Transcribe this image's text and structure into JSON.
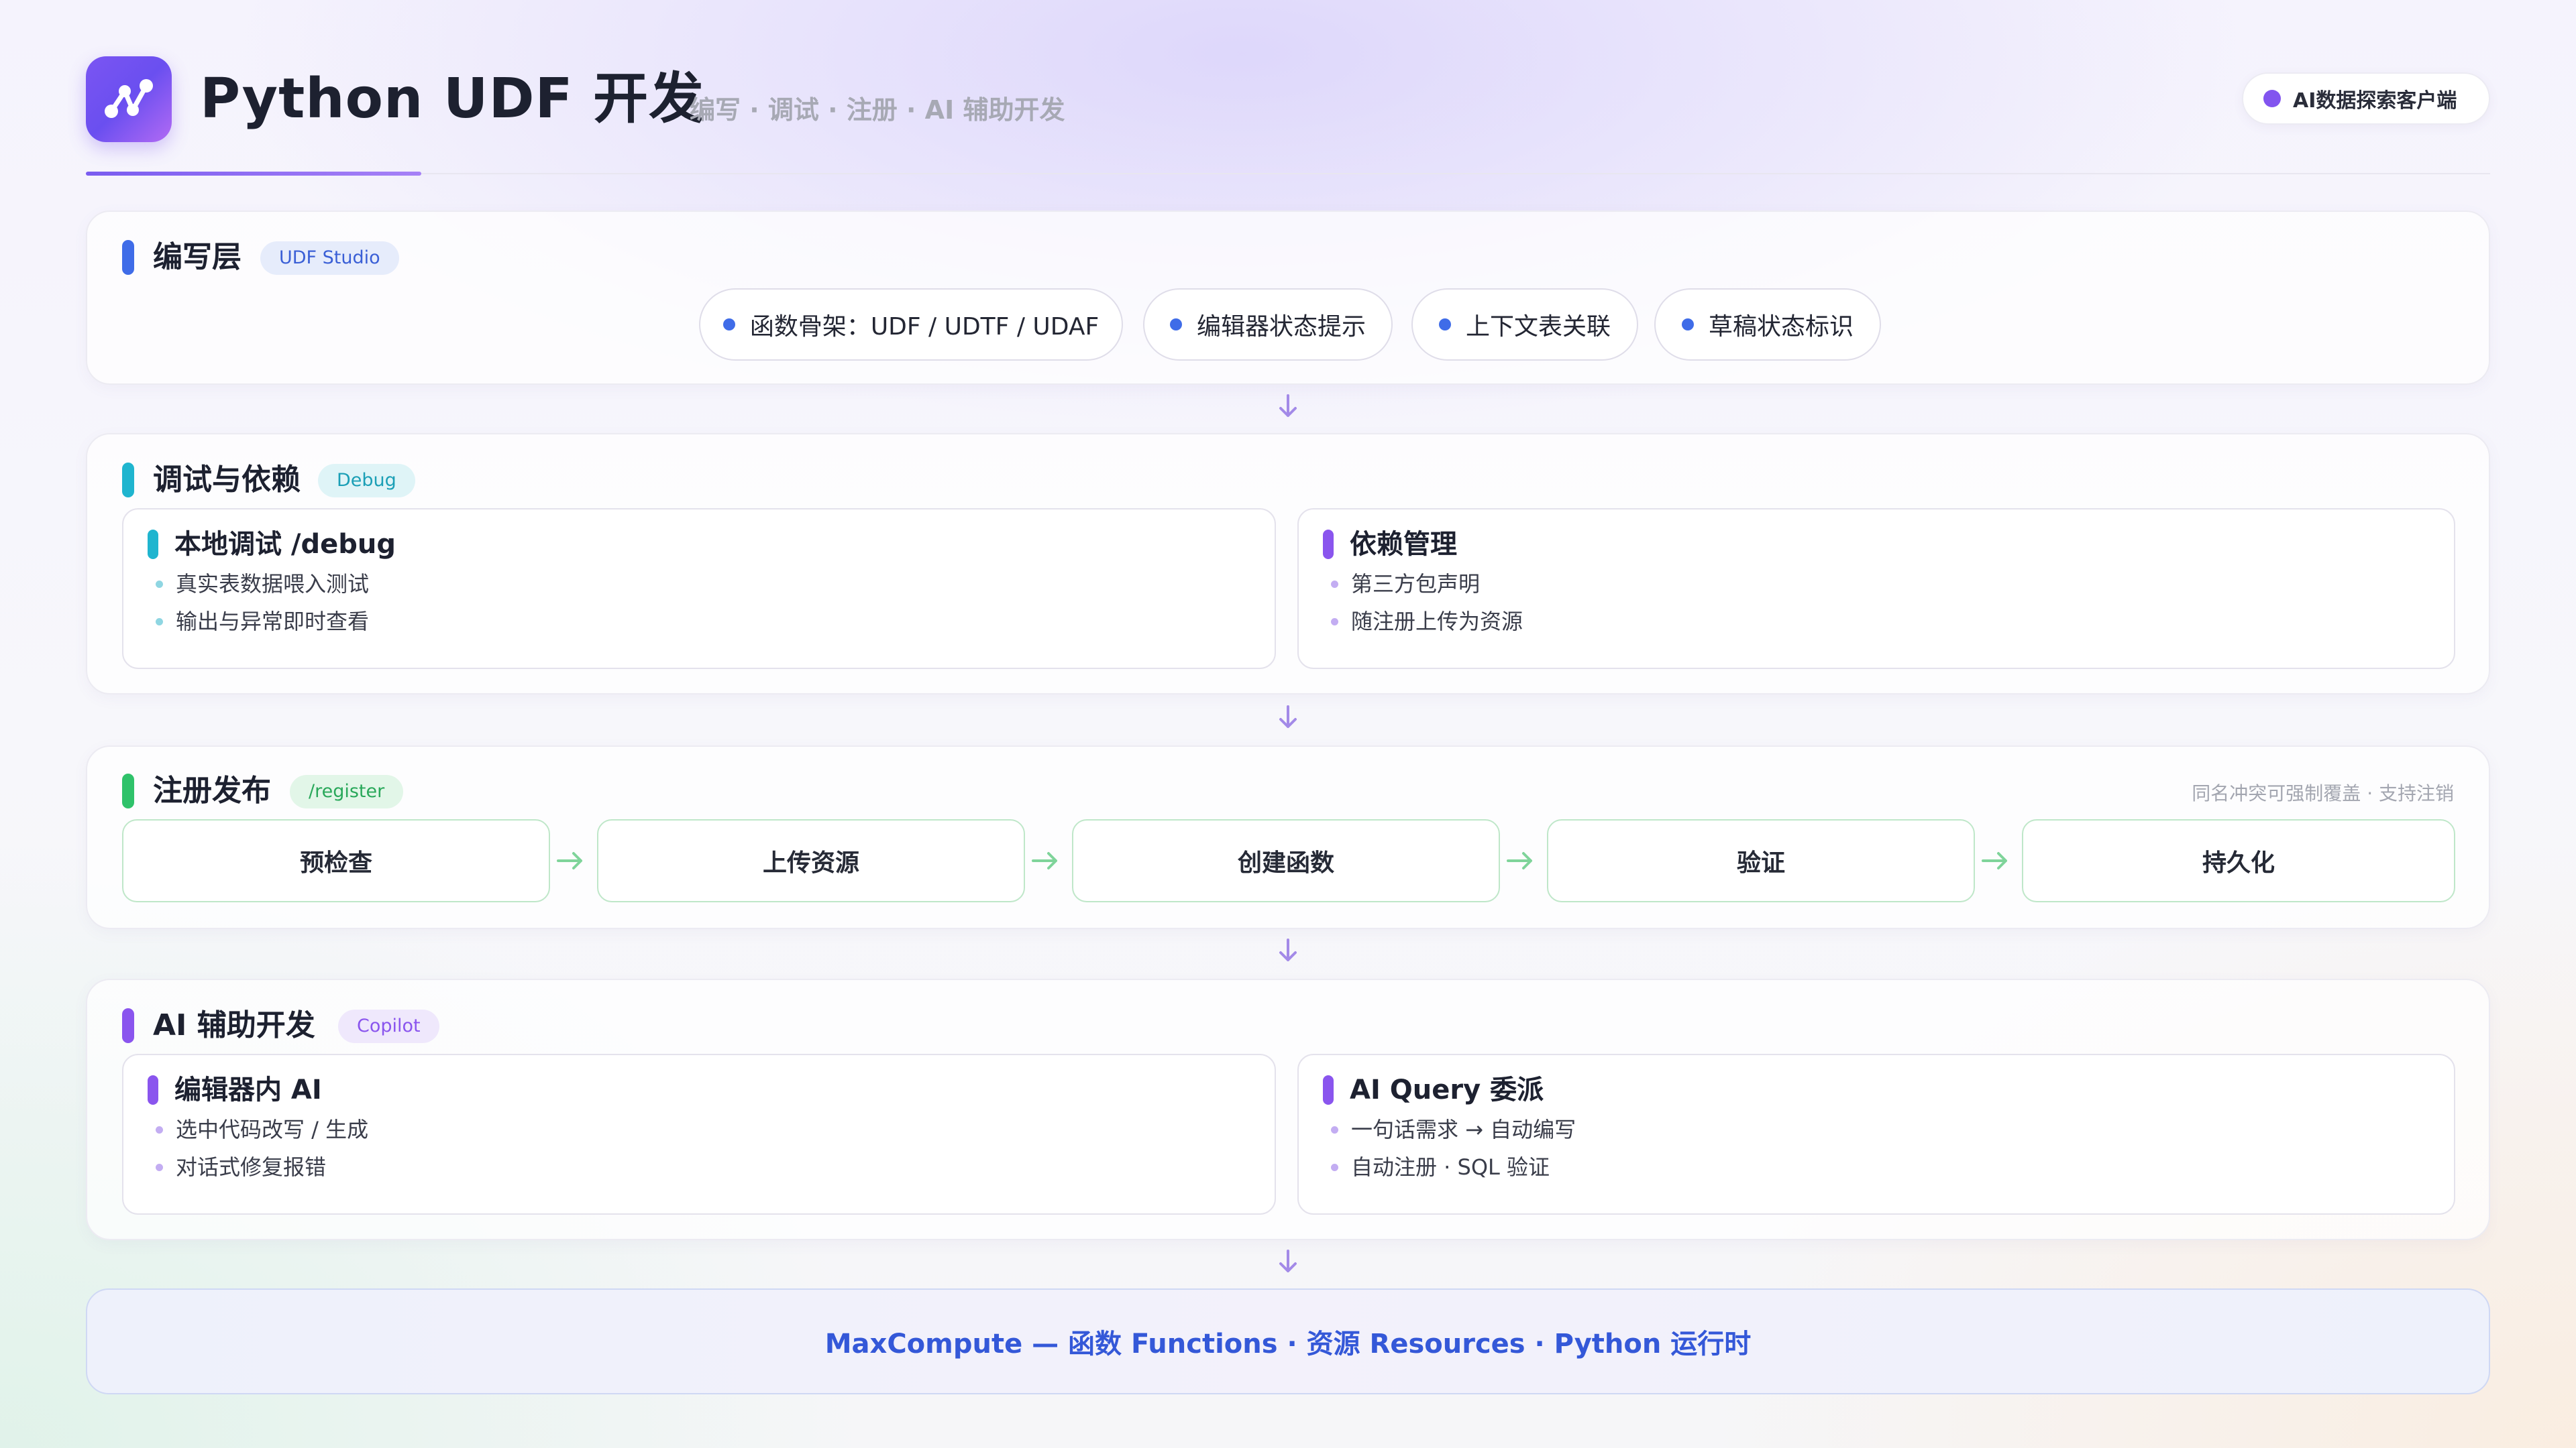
{
  "header": {
    "title": "Python UDF 开发",
    "subtitle": "编写 · 调试 · 注册 · AI 辅助开发",
    "badge": "AI数据探索客户端",
    "logo_icon": "branch-nodes-icon"
  },
  "colors": {
    "brand_purple": "#7b55f2",
    "blue": "#3f6ce8",
    "cyan": "#1fb5cf",
    "green": "#2fc26a",
    "violet": "#8a55ee",
    "footer_text": "#3458d8"
  },
  "sections": {
    "write": {
      "title": "编写层",
      "tag": "UDF Studio",
      "pills": [
        "函数骨架：UDF / UDTF / UDAF",
        "编辑器状态提示",
        "上下文表关联",
        "草稿状态标识"
      ]
    },
    "debug": {
      "title": "调试与依赖",
      "tag": "Debug",
      "cards": [
        {
          "title": "本地调试 /debug",
          "items": [
            "真实表数据喂入测试",
            "输出与异常即时查看"
          ]
        },
        {
          "title": "依赖管理",
          "items": [
            "第三方包声明",
            "随注册上传为资源"
          ]
        }
      ]
    },
    "register": {
      "title": "注册发布",
      "tag": "/register",
      "note": "同名冲突可强制覆盖 · 支持注销",
      "steps": [
        "预检查",
        "上传资源",
        "创建函数",
        "验证",
        "持久化"
      ]
    },
    "ai": {
      "title": "AI 辅助开发",
      "tag": "Copilot",
      "cards": [
        {
          "title": "编辑器内 AI",
          "items": [
            "选中代码改写 / 生成",
            "对话式修复报错"
          ]
        },
        {
          "title": "AI Query 委派",
          "items": [
            "一句话需求 → 自动编写",
            "自动注册 · SQL 验证"
          ]
        }
      ]
    }
  },
  "footer": {
    "text": "MaxCompute — 函数 Functions · 资源 Resources · Python 运行时"
  }
}
